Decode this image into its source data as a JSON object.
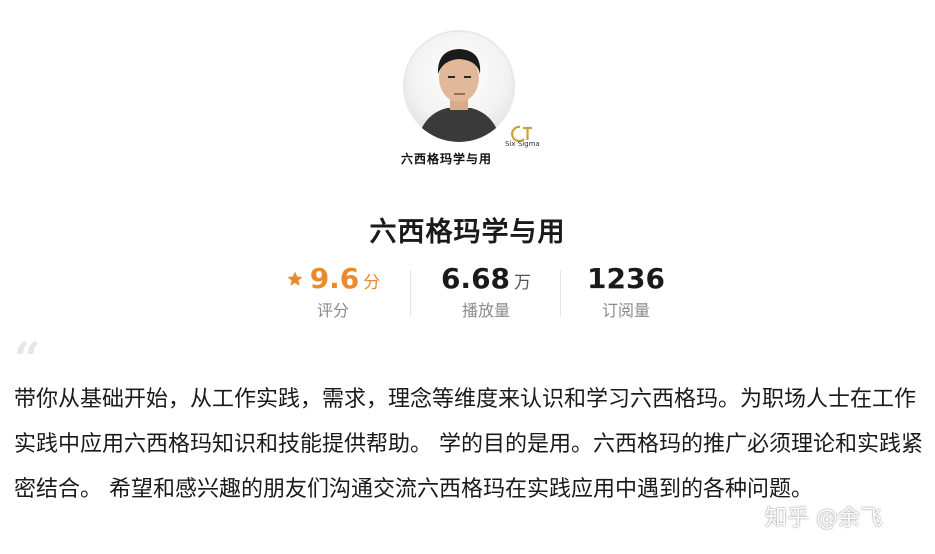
{
  "channel": {
    "logo_text": "六西格玛学与用",
    "logo_subtext": "Six Sigma",
    "title": "六西格玛学与用"
  },
  "stats": {
    "rating": {
      "value": "9.6",
      "unit": "分",
      "label": "评分",
      "icon": "star-icon",
      "color": "#ea8a2d"
    },
    "plays": {
      "value": "6.68",
      "unit": "万",
      "label": "播放量"
    },
    "subscriptions": {
      "value": "1236",
      "label": "订阅量"
    }
  },
  "description": {
    "quote_mark": "“",
    "text": "带你从基础开始，从工作实践，需求，理念等维度来认识和学习六西格玛。为职场人士在工作实践中应用六西格玛知识和技能提供帮助。 学的目的是用。六西格玛的推广必须理论和实践紧密结合。 希望和感兴趣的朋友们沟通交流六西格玛在实践应用中遇到的各种问题。"
  },
  "watermark": "知乎 @余飞"
}
